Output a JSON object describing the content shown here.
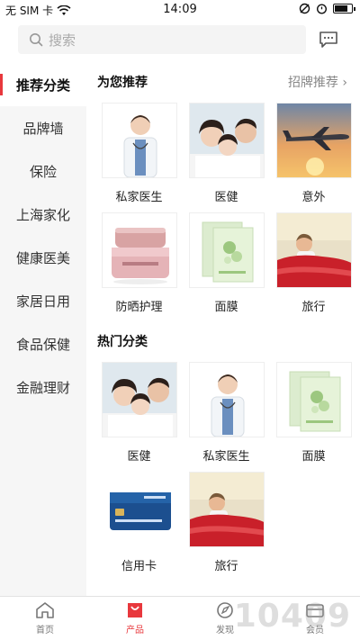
{
  "status": {
    "carrier": "无 SIM 卡",
    "time": "14:09",
    "battery_level": 0.85
  },
  "search": {
    "placeholder": "搜索"
  },
  "sidebar": {
    "items": [
      {
        "label": "推荐分类"
      },
      {
        "label": "品牌墙"
      },
      {
        "label": "保险"
      },
      {
        "label": "上海家化"
      },
      {
        "label": "健康医美"
      },
      {
        "label": "家居日用"
      },
      {
        "label": "食品保健"
      },
      {
        "label": "金融理财"
      }
    ]
  },
  "recommend": {
    "title": "为您推荐",
    "link": "招牌推荐",
    "items": [
      {
        "label": "私家医生",
        "icon": "doctor"
      },
      {
        "label": "医健",
        "icon": "family"
      },
      {
        "label": "意外",
        "icon": "airplane"
      },
      {
        "label": "防晒护理",
        "icon": "cream-jar"
      },
      {
        "label": "面膜",
        "icon": "face-mask"
      },
      {
        "label": "旅行",
        "icon": "car-travel"
      }
    ]
  },
  "hot": {
    "title": "热门分类",
    "items": [
      {
        "label": "医健",
        "icon": "family"
      },
      {
        "label": "私家医生",
        "icon": "doctor"
      },
      {
        "label": "面膜",
        "icon": "face-mask"
      },
      {
        "label": "信用卡",
        "icon": "credit-card"
      },
      {
        "label": "旅行",
        "icon": "car-travel"
      }
    ]
  },
  "tabbar": {
    "tabs": [
      {
        "label": "首页"
      },
      {
        "label": "产品"
      },
      {
        "label": "发现"
      },
      {
        "label": "会员"
      }
    ]
  },
  "watermark": "10409",
  "colors": {
    "accent": "#e8383d",
    "sidebar_bg": "#f6f6f6"
  }
}
